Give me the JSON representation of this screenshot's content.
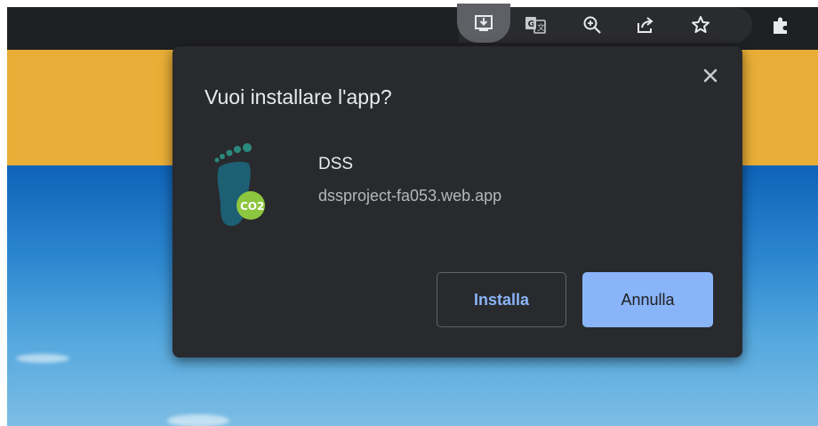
{
  "dialog": {
    "title": "Vuoi installare l'app?",
    "app_name": "DSS",
    "app_url": "dssproject-fa053.web.app",
    "install_label": "Installa",
    "cancel_label": "Annulla",
    "close_icon": "close-icon",
    "app_icon_text": "CO2"
  },
  "toolbar": {
    "icons": [
      "install-app-icon",
      "translate-icon",
      "zoom-icon",
      "share-icon",
      "bookmark-star-icon",
      "extensions-puzzle-icon"
    ]
  },
  "colors": {
    "dialog_bg": "#292a2d",
    "accent": "#8ab4f8",
    "header": "#e9ae37",
    "sky": "#0e63b8"
  }
}
